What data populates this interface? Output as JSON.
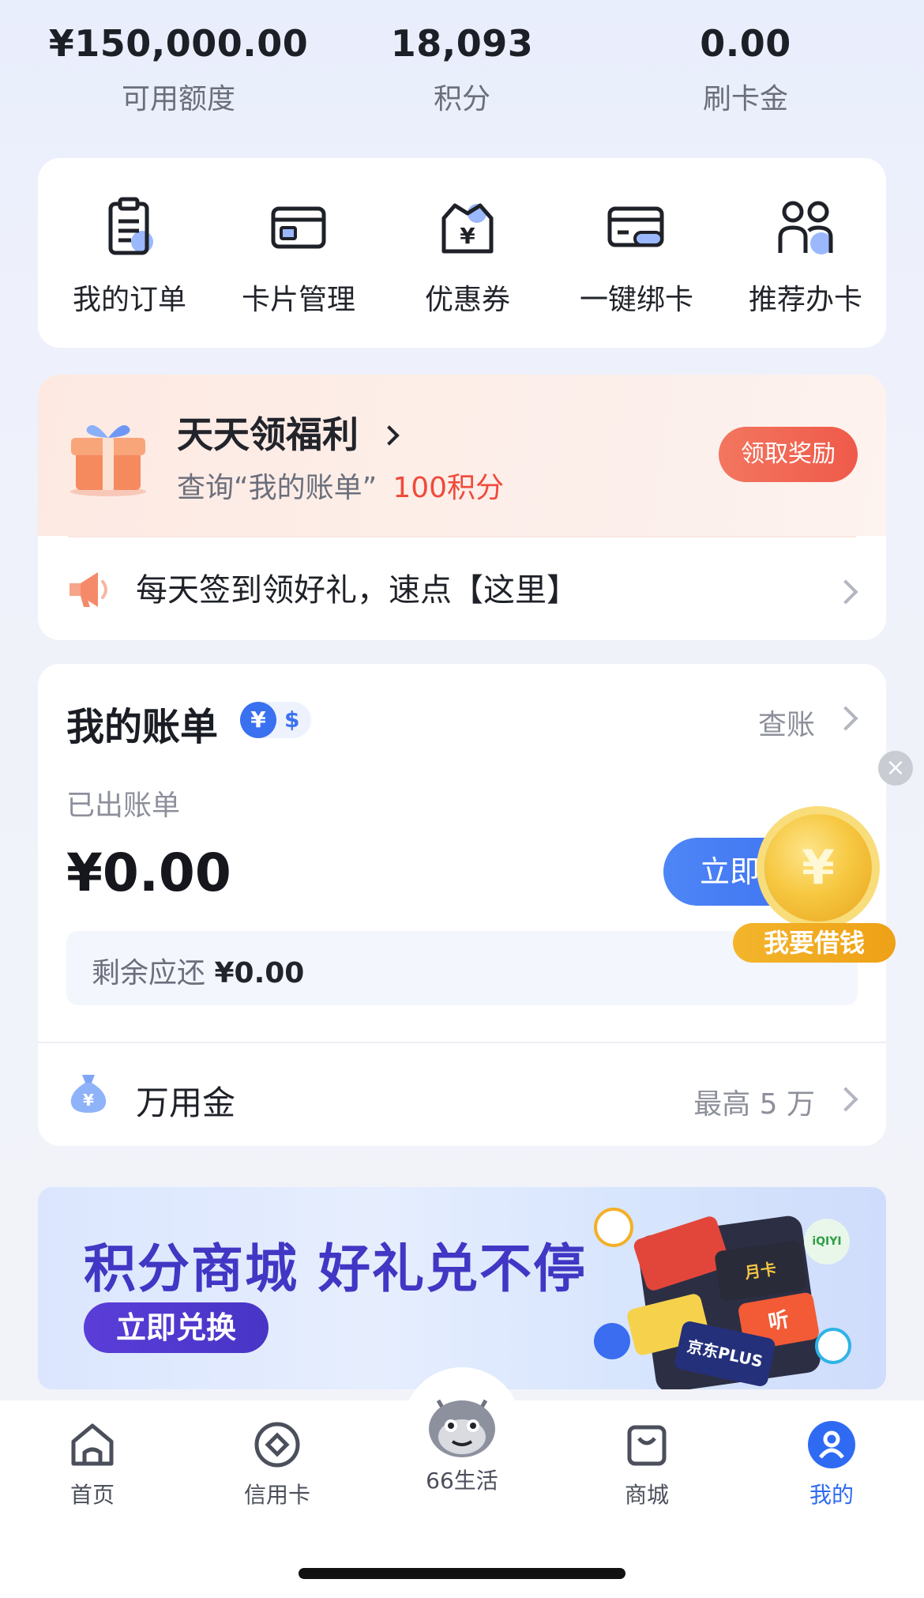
{
  "summary": [
    {
      "value": "¥150,000.00",
      "label": "可用额度"
    },
    {
      "value": "18,093",
      "label": "积分"
    },
    {
      "value": "0.00",
      "label": "刷卡金"
    }
  ],
  "actions": [
    {
      "label": "我的订单",
      "icon": "clipboard-icon"
    },
    {
      "label": "卡片管理",
      "icon": "card-icon"
    },
    {
      "label": "优惠券",
      "icon": "coupon-icon"
    },
    {
      "label": "一键绑卡",
      "icon": "card-link-icon"
    },
    {
      "label": "推荐办卡",
      "icon": "people-icon"
    }
  ],
  "welfare": {
    "title": "天天领福利",
    "sub_text": "查询“我的账单”",
    "sub_points": "100积分",
    "button": "领取奖励",
    "signin": "每天签到领好礼，速点【这里】"
  },
  "bill": {
    "title": "我的账单",
    "yen": "¥",
    "usd": "$",
    "check": "查账",
    "issued_label": "已出账单",
    "issued_amount": "¥0.00",
    "pay_button": "立即",
    "remain_label": "剩余应还",
    "remain_amount": "¥0.00",
    "wanyong_label": "万用金",
    "wanyong_max": "最高 5 万"
  },
  "float": {
    "close": "×",
    "coin": "¥",
    "label": "我要借钱"
  },
  "banner": {
    "title": "积分商城 好礼兑不停",
    "button": "立即兑换",
    "cards": [
      "月卡",
      "听",
      "京东PLUS",
      "iQIYI"
    ]
  },
  "tabs": [
    {
      "label": "首页",
      "icon": "home-icon"
    },
    {
      "label": "信用卡",
      "icon": "credit-card-icon"
    },
    {
      "label": "66生活",
      "icon": "dragon-mascot-icon"
    },
    {
      "label": "商城",
      "icon": "bag-icon"
    },
    {
      "label": "我的",
      "icon": "profile-icon",
      "active": true
    }
  ],
  "colors": {
    "accent": "#2f6bf2",
    "red": "#f04a3a",
    "gold": "#f3b52c",
    "banner_purple": "#4137c4"
  }
}
